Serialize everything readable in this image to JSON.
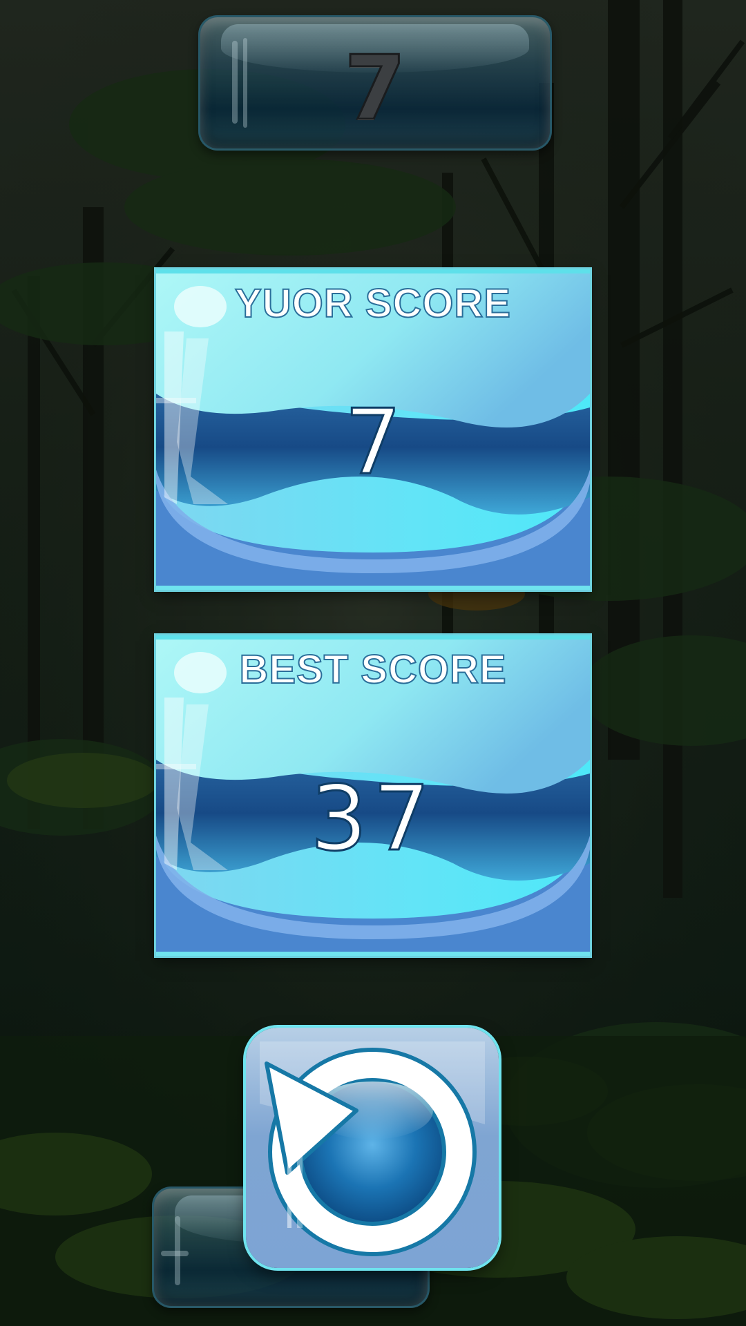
{
  "top_panel": {
    "score": "7"
  },
  "your_score": {
    "label": "YUOR SCORE",
    "value": "7"
  },
  "best_score": {
    "label": "BEST SCORE",
    "value": "37"
  },
  "buttons": {
    "restart_icon": "restart-icon",
    "menu_icon": "menu-button-icon"
  },
  "colors": {
    "card_top": "#9ff4f6",
    "card_band": "#1f5e9a",
    "card_bottom": "#5fe9f6",
    "card_frame": "#4a86cf",
    "restart_outline": "#1678a6"
  }
}
